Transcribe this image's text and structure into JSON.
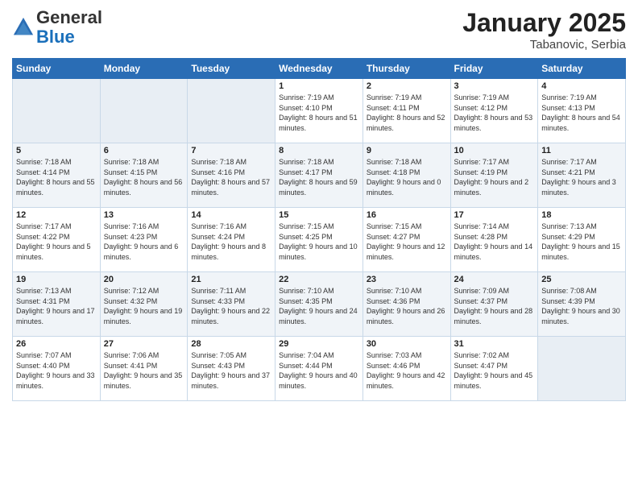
{
  "logo": {
    "general": "General",
    "blue": "Blue"
  },
  "title": "January 2025",
  "location": "Tabanovic, Serbia",
  "days_of_week": [
    "Sunday",
    "Monday",
    "Tuesday",
    "Wednesday",
    "Thursday",
    "Friday",
    "Saturday"
  ],
  "weeks": [
    [
      {
        "day": "",
        "info": "",
        "empty": true
      },
      {
        "day": "",
        "info": "",
        "empty": true
      },
      {
        "day": "",
        "info": "",
        "empty": true
      },
      {
        "day": "1",
        "info": "Sunrise: 7:19 AM\nSunset: 4:10 PM\nDaylight: 8 hours and 51 minutes.",
        "empty": false
      },
      {
        "day": "2",
        "info": "Sunrise: 7:19 AM\nSunset: 4:11 PM\nDaylight: 8 hours and 52 minutes.",
        "empty": false
      },
      {
        "day": "3",
        "info": "Sunrise: 7:19 AM\nSunset: 4:12 PM\nDaylight: 8 hours and 53 minutes.",
        "empty": false
      },
      {
        "day": "4",
        "info": "Sunrise: 7:19 AM\nSunset: 4:13 PM\nDaylight: 8 hours and 54 minutes.",
        "empty": false
      }
    ],
    [
      {
        "day": "5",
        "info": "Sunrise: 7:18 AM\nSunset: 4:14 PM\nDaylight: 8 hours and 55 minutes.",
        "empty": false
      },
      {
        "day": "6",
        "info": "Sunrise: 7:18 AM\nSunset: 4:15 PM\nDaylight: 8 hours and 56 minutes.",
        "empty": false
      },
      {
        "day": "7",
        "info": "Sunrise: 7:18 AM\nSunset: 4:16 PM\nDaylight: 8 hours and 57 minutes.",
        "empty": false
      },
      {
        "day": "8",
        "info": "Sunrise: 7:18 AM\nSunset: 4:17 PM\nDaylight: 8 hours and 59 minutes.",
        "empty": false
      },
      {
        "day": "9",
        "info": "Sunrise: 7:18 AM\nSunset: 4:18 PM\nDaylight: 9 hours and 0 minutes.",
        "empty": false
      },
      {
        "day": "10",
        "info": "Sunrise: 7:17 AM\nSunset: 4:19 PM\nDaylight: 9 hours and 2 minutes.",
        "empty": false
      },
      {
        "day": "11",
        "info": "Sunrise: 7:17 AM\nSunset: 4:21 PM\nDaylight: 9 hours and 3 minutes.",
        "empty": false
      }
    ],
    [
      {
        "day": "12",
        "info": "Sunrise: 7:17 AM\nSunset: 4:22 PM\nDaylight: 9 hours and 5 minutes.",
        "empty": false
      },
      {
        "day": "13",
        "info": "Sunrise: 7:16 AM\nSunset: 4:23 PM\nDaylight: 9 hours and 6 minutes.",
        "empty": false
      },
      {
        "day": "14",
        "info": "Sunrise: 7:16 AM\nSunset: 4:24 PM\nDaylight: 9 hours and 8 minutes.",
        "empty": false
      },
      {
        "day": "15",
        "info": "Sunrise: 7:15 AM\nSunset: 4:25 PM\nDaylight: 9 hours and 10 minutes.",
        "empty": false
      },
      {
        "day": "16",
        "info": "Sunrise: 7:15 AM\nSunset: 4:27 PM\nDaylight: 9 hours and 12 minutes.",
        "empty": false
      },
      {
        "day": "17",
        "info": "Sunrise: 7:14 AM\nSunset: 4:28 PM\nDaylight: 9 hours and 14 minutes.",
        "empty": false
      },
      {
        "day": "18",
        "info": "Sunrise: 7:13 AM\nSunset: 4:29 PM\nDaylight: 9 hours and 15 minutes.",
        "empty": false
      }
    ],
    [
      {
        "day": "19",
        "info": "Sunrise: 7:13 AM\nSunset: 4:31 PM\nDaylight: 9 hours and 17 minutes.",
        "empty": false
      },
      {
        "day": "20",
        "info": "Sunrise: 7:12 AM\nSunset: 4:32 PM\nDaylight: 9 hours and 19 minutes.",
        "empty": false
      },
      {
        "day": "21",
        "info": "Sunrise: 7:11 AM\nSunset: 4:33 PM\nDaylight: 9 hours and 22 minutes.",
        "empty": false
      },
      {
        "day": "22",
        "info": "Sunrise: 7:10 AM\nSunset: 4:35 PM\nDaylight: 9 hours and 24 minutes.",
        "empty": false
      },
      {
        "day": "23",
        "info": "Sunrise: 7:10 AM\nSunset: 4:36 PM\nDaylight: 9 hours and 26 minutes.",
        "empty": false
      },
      {
        "day": "24",
        "info": "Sunrise: 7:09 AM\nSunset: 4:37 PM\nDaylight: 9 hours and 28 minutes.",
        "empty": false
      },
      {
        "day": "25",
        "info": "Sunrise: 7:08 AM\nSunset: 4:39 PM\nDaylight: 9 hours and 30 minutes.",
        "empty": false
      }
    ],
    [
      {
        "day": "26",
        "info": "Sunrise: 7:07 AM\nSunset: 4:40 PM\nDaylight: 9 hours and 33 minutes.",
        "empty": false
      },
      {
        "day": "27",
        "info": "Sunrise: 7:06 AM\nSunset: 4:41 PM\nDaylight: 9 hours and 35 minutes.",
        "empty": false
      },
      {
        "day": "28",
        "info": "Sunrise: 7:05 AM\nSunset: 4:43 PM\nDaylight: 9 hours and 37 minutes.",
        "empty": false
      },
      {
        "day": "29",
        "info": "Sunrise: 7:04 AM\nSunset: 4:44 PM\nDaylight: 9 hours and 40 minutes.",
        "empty": false
      },
      {
        "day": "30",
        "info": "Sunrise: 7:03 AM\nSunset: 4:46 PM\nDaylight: 9 hours and 42 minutes.",
        "empty": false
      },
      {
        "day": "31",
        "info": "Sunrise: 7:02 AM\nSunset: 4:47 PM\nDaylight: 9 hours and 45 minutes.",
        "empty": false
      },
      {
        "day": "",
        "info": "",
        "empty": true
      }
    ]
  ]
}
